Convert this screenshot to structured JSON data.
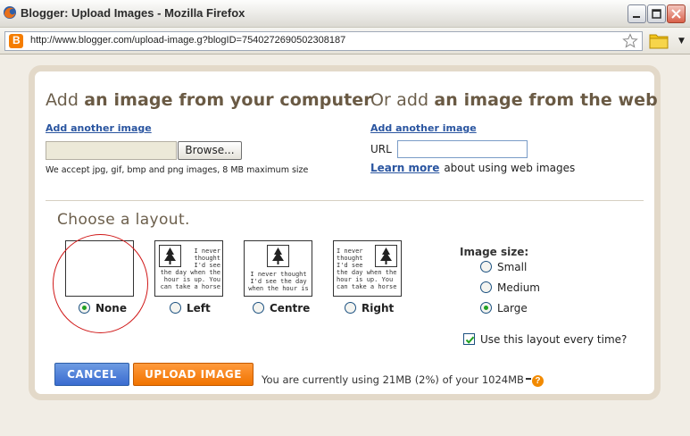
{
  "window": {
    "title": "Blogger: Upload Images - Mozilla Firefox"
  },
  "browser": {
    "url": "http://www.blogger.com/upload-image.g?blogID=7540272690502308187"
  },
  "computer_section": {
    "title_prefix": "Add",
    "title_bold": "an image from your computer",
    "add_another": "Add another image",
    "browse_label": "Browse...",
    "accept_note": "We accept jpg, gif, bmp and png images, 8 MB maximum size"
  },
  "web_section": {
    "title_prefix": "Or add",
    "title_bold": "an image from the web",
    "add_another": "Add another image",
    "url_label": "URL",
    "url_value": "",
    "learn_more": "Learn more",
    "learn_more_suffix": "about using web images"
  },
  "layout": {
    "title": "Choose a layout.",
    "options": [
      {
        "label": "None",
        "selected": true
      },
      {
        "label": "Left",
        "selected": false
      },
      {
        "label": "Centre",
        "selected": false
      },
      {
        "label": "Right",
        "selected": false
      }
    ],
    "sample_text_left": "I never\nthought\nI'd see\nthe day when the\nhour is up. You\ncan take a horse",
    "sample_text_centre": "I never thought\nI'd see the day\nwhen the hour is",
    "sample_text_right": "I never\nthought\nI'd see\nthe day when the\nhour is up. You\ncan take a horse"
  },
  "image_size": {
    "title": "Image size:",
    "options": [
      {
        "label": "Small",
        "selected": false
      },
      {
        "label": "Medium",
        "selected": false
      },
      {
        "label": "Large",
        "selected": true
      }
    ]
  },
  "remember_layout": {
    "label": "Use this layout every time?",
    "checked": true
  },
  "buttons": {
    "cancel": "CANCEL",
    "upload": "UPLOAD IMAGE"
  },
  "usage_text": "You are currently using 21MB (2%) of your 1024MB",
  "help_glyph": "?",
  "colors": {
    "accent_orange": "#f07300",
    "accent_blue": "#3a6bd0",
    "link": "#2a55a0",
    "annotation_red": "#d01818"
  }
}
